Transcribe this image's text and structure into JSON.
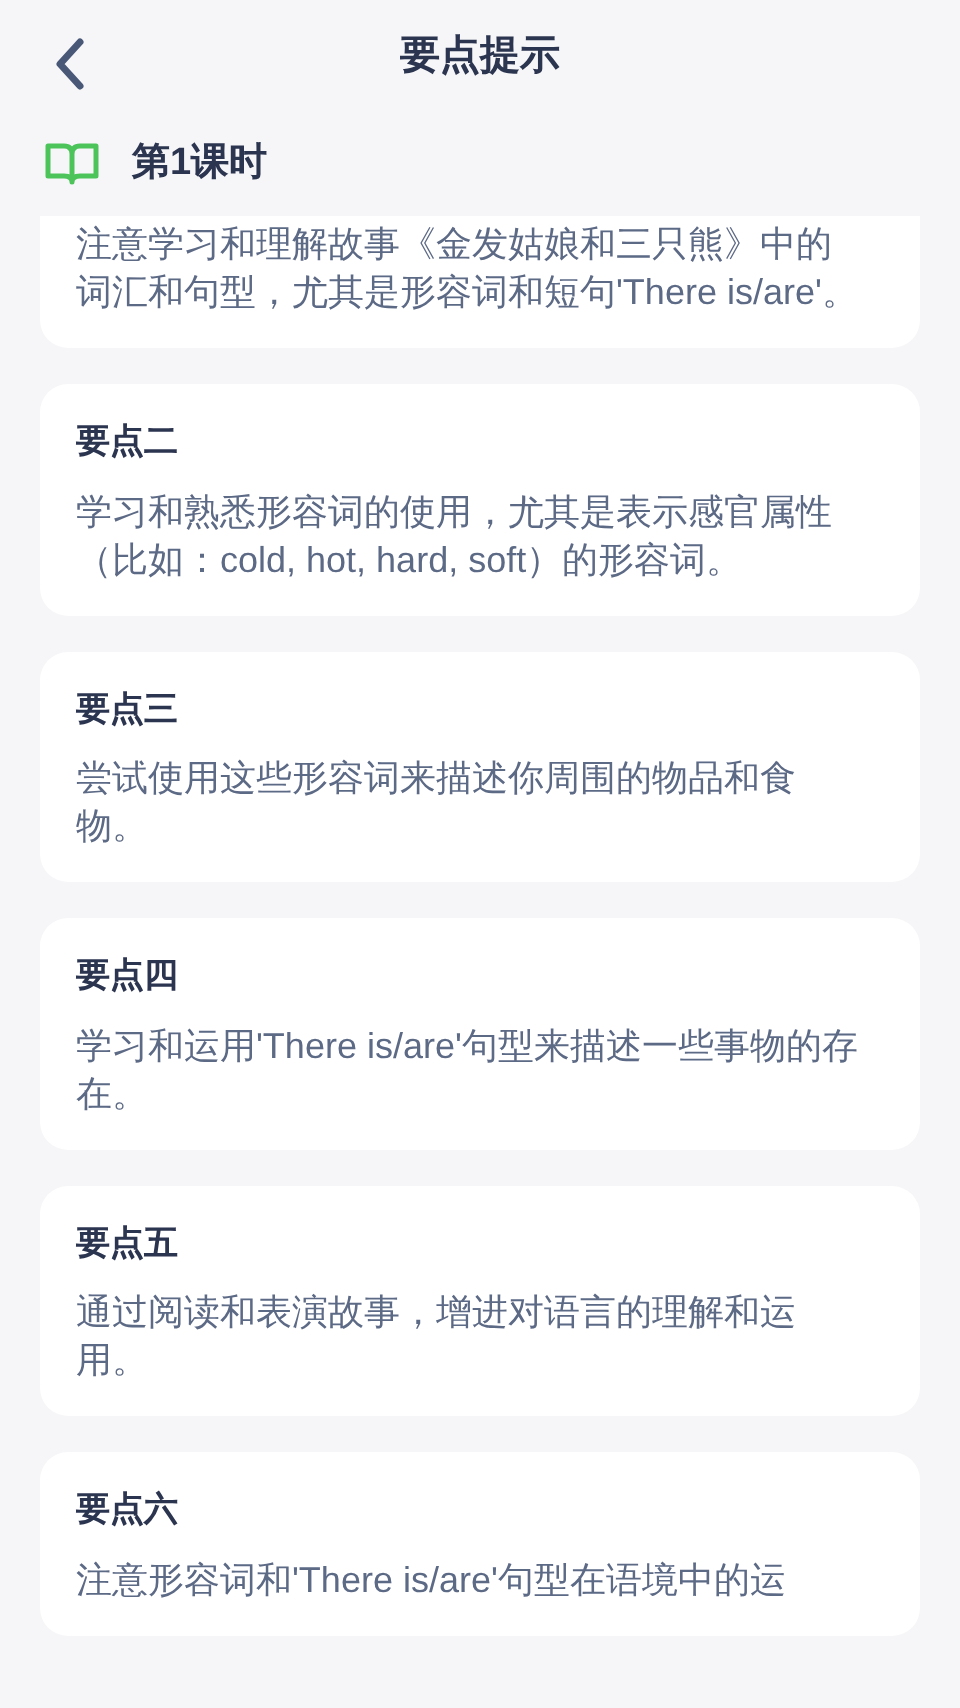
{
  "header": {
    "title": "要点提示"
  },
  "lesson": {
    "title": "第1课时"
  },
  "points": [
    {
      "body": "注意学习和理解故事《金发姑娘和三只熊》中的词汇和句型，尤其是形容词和短句'There is/are'。",
      "clipped_top": true
    },
    {
      "title": "要点二",
      "body": "学习和熟悉形容词的使用，尤其是表示感官属性（比如：cold, hot, hard, soft）的形容词。"
    },
    {
      "title": "要点三",
      "body": "尝试使用这些形容词来描述你周围的物品和食物。"
    },
    {
      "title": "要点四",
      "body": "学习和运用'There is/are'句型来描述一些事物的存在。"
    },
    {
      "title": "要点五",
      "body": "通过阅读和表演故事，增进对语言的理解和运用。"
    },
    {
      "title": "要点六",
      "body": "注意形容词和'There is/are'句型在语境中的运"
    }
  ]
}
